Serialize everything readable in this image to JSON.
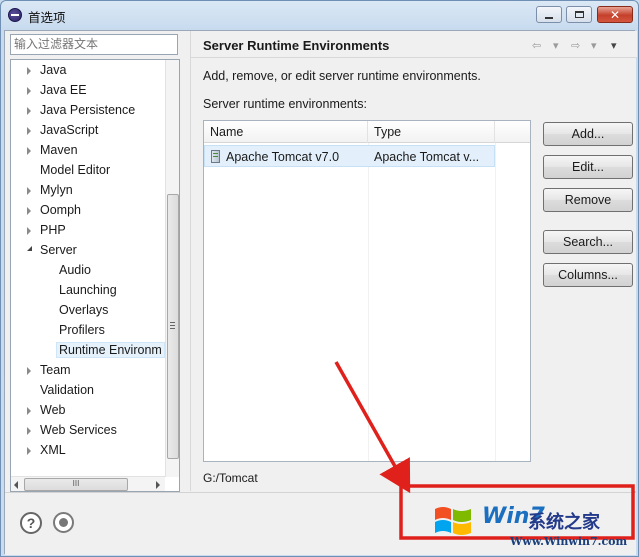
{
  "window": {
    "title": "首选项"
  },
  "filter": {
    "placeholder": "输入过滤器文本"
  },
  "tree": {
    "items": [
      {
        "label": "Java",
        "level": 0,
        "expandable": true,
        "expanded": false
      },
      {
        "label": "Java EE",
        "level": 0,
        "expandable": true,
        "expanded": false
      },
      {
        "label": "Java Persistence",
        "level": 0,
        "expandable": true,
        "expanded": false
      },
      {
        "label": "JavaScript",
        "level": 0,
        "expandable": true,
        "expanded": false
      },
      {
        "label": "Maven",
        "level": 0,
        "expandable": true,
        "expanded": false
      },
      {
        "label": "Model Editor",
        "level": 0,
        "expandable": false,
        "expanded": false
      },
      {
        "label": "Mylyn",
        "level": 0,
        "expandable": true,
        "expanded": false
      },
      {
        "label": "Oomph",
        "level": 0,
        "expandable": true,
        "expanded": false
      },
      {
        "label": "PHP",
        "level": 0,
        "expandable": true,
        "expanded": false
      },
      {
        "label": "Server",
        "level": 0,
        "expandable": true,
        "expanded": true
      },
      {
        "label": "Audio",
        "level": 1,
        "expandable": false,
        "expanded": false
      },
      {
        "label": "Launching",
        "level": 1,
        "expandable": false,
        "expanded": false
      },
      {
        "label": "Overlays",
        "level": 1,
        "expandable": false,
        "expanded": false
      },
      {
        "label": "Profilers",
        "level": 1,
        "expandable": false,
        "expanded": false
      },
      {
        "label": "Runtime Environm",
        "level": 1,
        "expandable": false,
        "expanded": false,
        "selected": true
      },
      {
        "label": "Team",
        "level": 0,
        "expandable": true,
        "expanded": false
      },
      {
        "label": "Validation",
        "level": 0,
        "expandable": false,
        "expanded": false
      },
      {
        "label": "Web",
        "level": 0,
        "expandable": true,
        "expanded": false
      },
      {
        "label": "Web Services",
        "level": 0,
        "expandable": true,
        "expanded": false
      },
      {
        "label": "XML",
        "level": 0,
        "expandable": true,
        "expanded": false
      }
    ],
    "hscroll_grip": "III"
  },
  "page": {
    "title": "Server Runtime Environments",
    "description": "Add, remove, or edit server runtime environments.",
    "list_label": "Server runtime environments:",
    "columns": [
      "Name",
      "Type"
    ],
    "rows": [
      {
        "name": "Apache Tomcat v7.0",
        "type": "Apache Tomcat v...",
        "selected": true
      }
    ],
    "buttons": {
      "add": "Add...",
      "edit": "Edit...",
      "remove": "Remove",
      "search": "Search...",
      "columns": "Columns..."
    },
    "location": "G:/Tomcat"
  },
  "nav": {
    "back": "⇦",
    "forward": "⇨",
    "dropdown": "▾",
    "menu": "▾"
  },
  "bottom": {
    "help": "?"
  },
  "watermark": {
    "brand": "Win7",
    "brand_cn": "系统之家",
    "url": "Www.Winwin7.com"
  },
  "colors": {
    "annotation_red": "#e0201b",
    "selection": "#e3f0fb"
  }
}
